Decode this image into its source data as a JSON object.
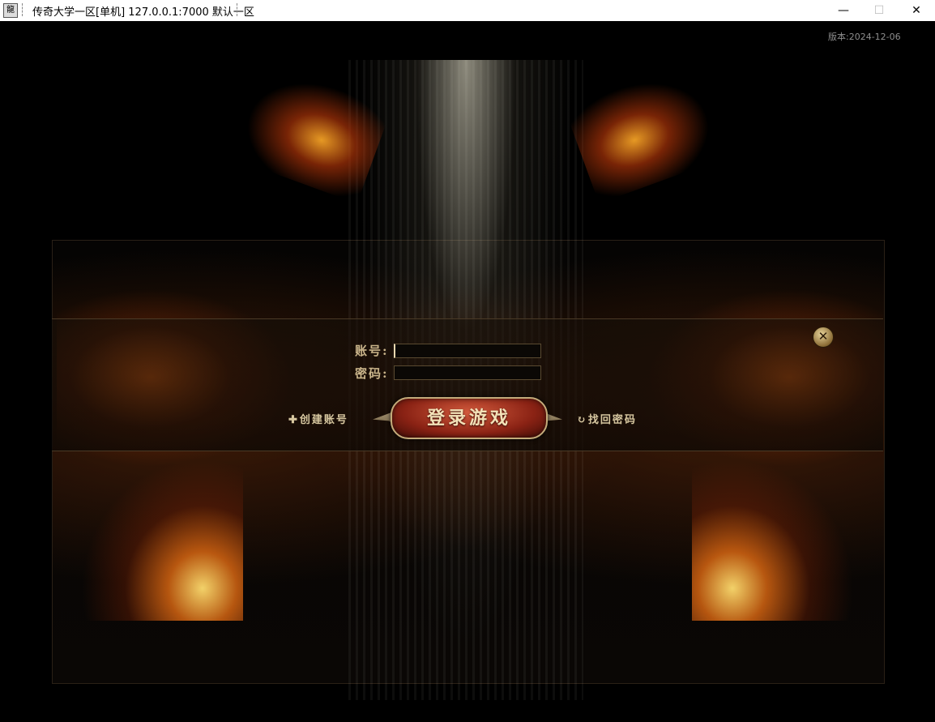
{
  "window": {
    "icon_glyph": "龍",
    "title": "传奇大学一区[单机] 127.0.0.1:7000  默认一区",
    "controls": {
      "minimize": "—",
      "maximize": "☐",
      "close": "✕"
    }
  },
  "game": {
    "version_text": "版本:2024-12-06",
    "login": {
      "account_label": "账号:",
      "account_value": "",
      "password_label": "密码:",
      "password_value": "",
      "create_account": "创建账号",
      "login_button": "登录游戏",
      "recover_password": "找回密码",
      "close_glyph": "✕"
    }
  }
}
